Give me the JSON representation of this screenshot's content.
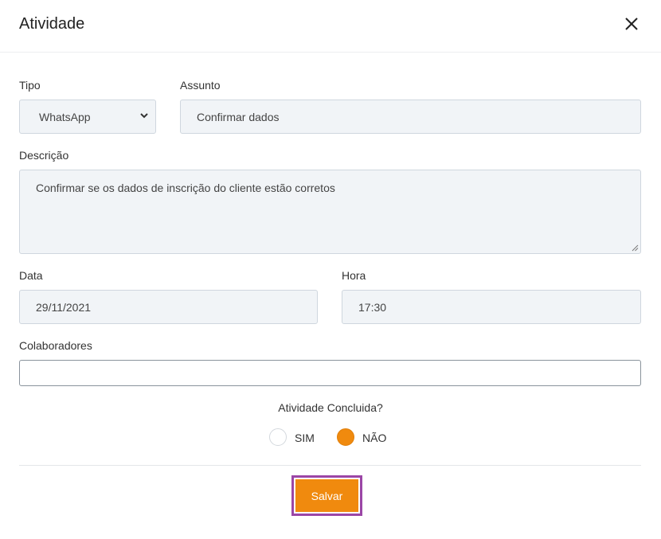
{
  "dialog": {
    "title": "Atividade",
    "close_icon": "close-icon"
  },
  "form": {
    "tipo": {
      "label": "Tipo",
      "value": "WhatsApp"
    },
    "assunto": {
      "label": "Assunto",
      "value": "Confirmar dados"
    },
    "descricao": {
      "label": "Descrição",
      "value": "Confirmar se os dados de inscrição do cliente estão corretos"
    },
    "data": {
      "label": "Data",
      "value": "29/11/2021"
    },
    "hora": {
      "label": "Hora",
      "value": "17:30"
    },
    "colaboradores": {
      "label": "Colaboradores",
      "value": ""
    }
  },
  "concluida": {
    "question": "Atividade Concluida?",
    "options": [
      {
        "label": "SIM",
        "selected": false
      },
      {
        "label": "NÃO",
        "selected": true
      }
    ]
  },
  "actions": {
    "save_label": "Salvar"
  },
  "colors": {
    "accent": "#f08a0e",
    "focus_outline": "#9b46a6",
    "field_bg": "#f1f4f7"
  }
}
